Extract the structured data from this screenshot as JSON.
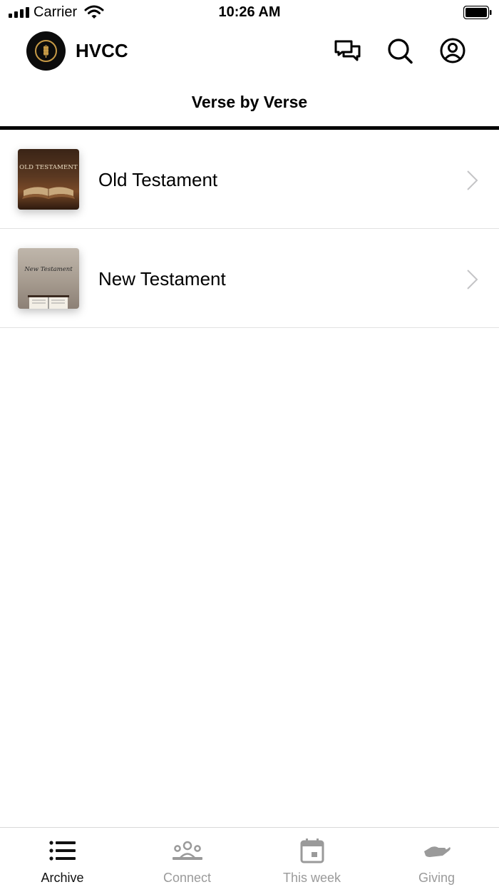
{
  "status_bar": {
    "carrier": "Carrier",
    "time": "10:26 AM"
  },
  "header": {
    "app_title": "HVCC",
    "icons": [
      "chat-icon",
      "search-icon",
      "profile-icon"
    ]
  },
  "section": {
    "title": "Verse by Verse"
  },
  "list": {
    "items": [
      {
        "label": "Old Testament",
        "thumbnail_text": "OLD TESTAMENT"
      },
      {
        "label": "New Testament",
        "thumbnail_text": "New Testament"
      }
    ]
  },
  "tab_bar": {
    "tabs": [
      {
        "label": "Archive",
        "icon": "list-icon",
        "active": true
      },
      {
        "label": "Connect",
        "icon": "group-icon",
        "active": false
      },
      {
        "label": "This week",
        "icon": "calendar-icon",
        "active": false
      },
      {
        "label": "Giving",
        "icon": "giving-hand-icon",
        "active": false
      }
    ]
  },
  "colors": {
    "active_tab": "#111111",
    "inactive_tab": "#9a9a9a",
    "divider": "#e2e2e2",
    "logo_accent": "#c79a46"
  }
}
